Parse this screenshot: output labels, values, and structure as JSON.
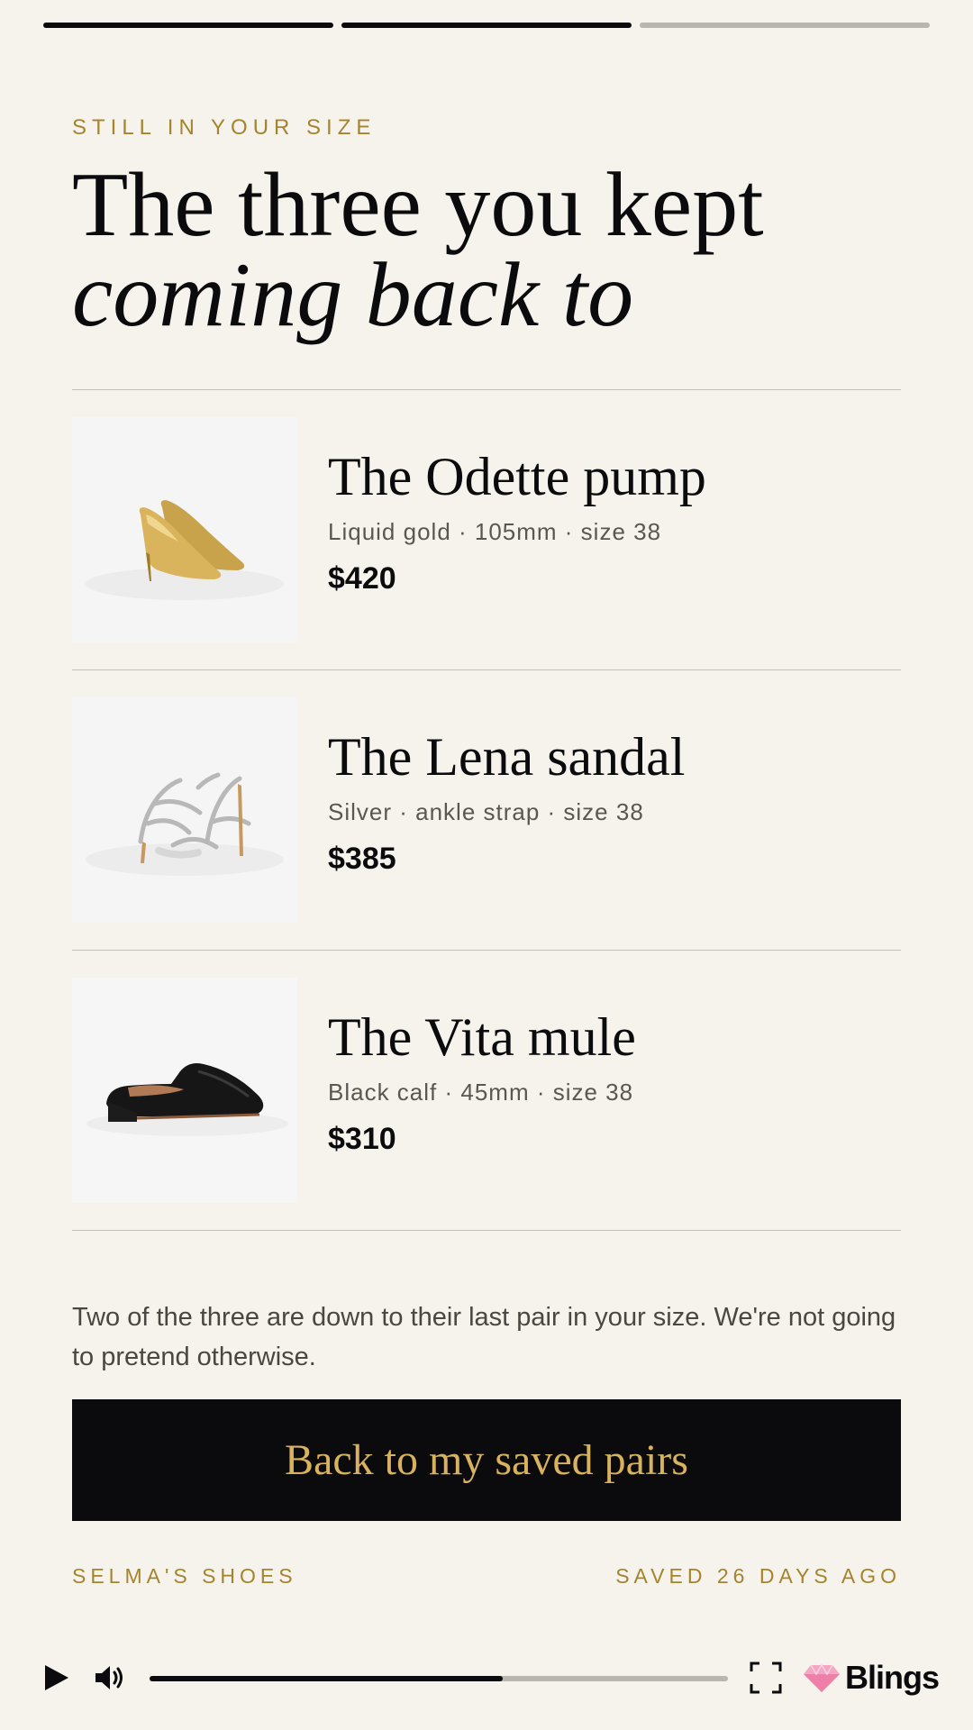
{
  "story": {
    "segments": [
      {
        "state": "done"
      },
      {
        "state": "done"
      },
      {
        "state": "pending"
      }
    ]
  },
  "header": {
    "eyebrow": "STILL IN YOUR SIZE",
    "headline_line1": "The three you kept",
    "headline_line2": "coming back to"
  },
  "products": [
    {
      "name": "The Odette pump",
      "spec": "Liquid gold · 105mm · size 38",
      "price": "$420",
      "image": "gold-pump-image"
    },
    {
      "name": "The Lena sandal",
      "spec": "Silver · ankle strap · size 38",
      "price": "$385",
      "image": "silver-sandal-image"
    },
    {
      "name": "The Vita mule",
      "spec": "Black calf · 45mm · size 38",
      "price": "$310",
      "image": "black-mule-image"
    }
  ],
  "note": "Two of the three are down to their last pair in your size. We're not going to pretend otherwise.",
  "cta": {
    "label": "Back to my saved pairs"
  },
  "footer": {
    "brand": "SELMA'S SHOES",
    "saved": "SAVED 26 DAYS AGO"
  },
  "player": {
    "progress": 0.61,
    "icons": [
      "play-icon",
      "volume-icon",
      "fullscreen-icon",
      "blings-logo"
    ],
    "brand": "Blings"
  },
  "colors": {
    "background": "#f6f2ec",
    "accent_gold": "#a5842e",
    "cta_text": "#d8b25e",
    "ink": "#0b0b0d"
  }
}
